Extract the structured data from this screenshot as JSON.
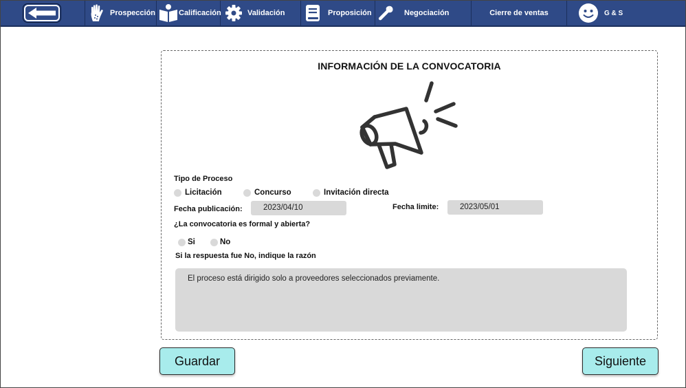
{
  "nav": {
    "items": [
      {
        "label": "Prospección",
        "icon": "hand-icon"
      },
      {
        "label": "Calificación",
        "icon": "reading-person-icon"
      },
      {
        "label": "Validación",
        "icon": "gear-icon"
      },
      {
        "label": "Proposición",
        "icon": "book-icon"
      },
      {
        "label": "Negociación",
        "icon": "wrench-icon"
      },
      {
        "label": "Cierre de ventas",
        "icon": ""
      },
      {
        "label": "G & S",
        "icon": "smiley-icon"
      }
    ],
    "back_icon": "arrow-left-icon",
    "colors": {
      "bar": "#2f4a87",
      "text": "#ffffff"
    }
  },
  "form": {
    "title": "INFORMACIÓN DE LA CONVOCATORIA",
    "illustration": "megaphone-icon",
    "tipo_label": "Tipo de Proceso",
    "tipo_options": [
      "Licitación",
      "Concurso",
      "Invitación directa"
    ],
    "fecha_pub_label": "Fecha publicación:",
    "fecha_pub_value": "2023/04/10",
    "fecha_lim_label": "Fecha limite:",
    "fecha_lim_value": "2023/05/01",
    "formal_question": "¿La convocatoria es formal y abierta?",
    "formal_options": [
      "Si",
      "No"
    ],
    "reason_label": "Si la respuesta fue No, indique la razón",
    "reason_value": "El proceso está dirigido solo a proveedores seleccionados previamente."
  },
  "actions": {
    "save_label": "Guardar",
    "next_label": "Siguiente",
    "button_color": "#a8ecec"
  }
}
